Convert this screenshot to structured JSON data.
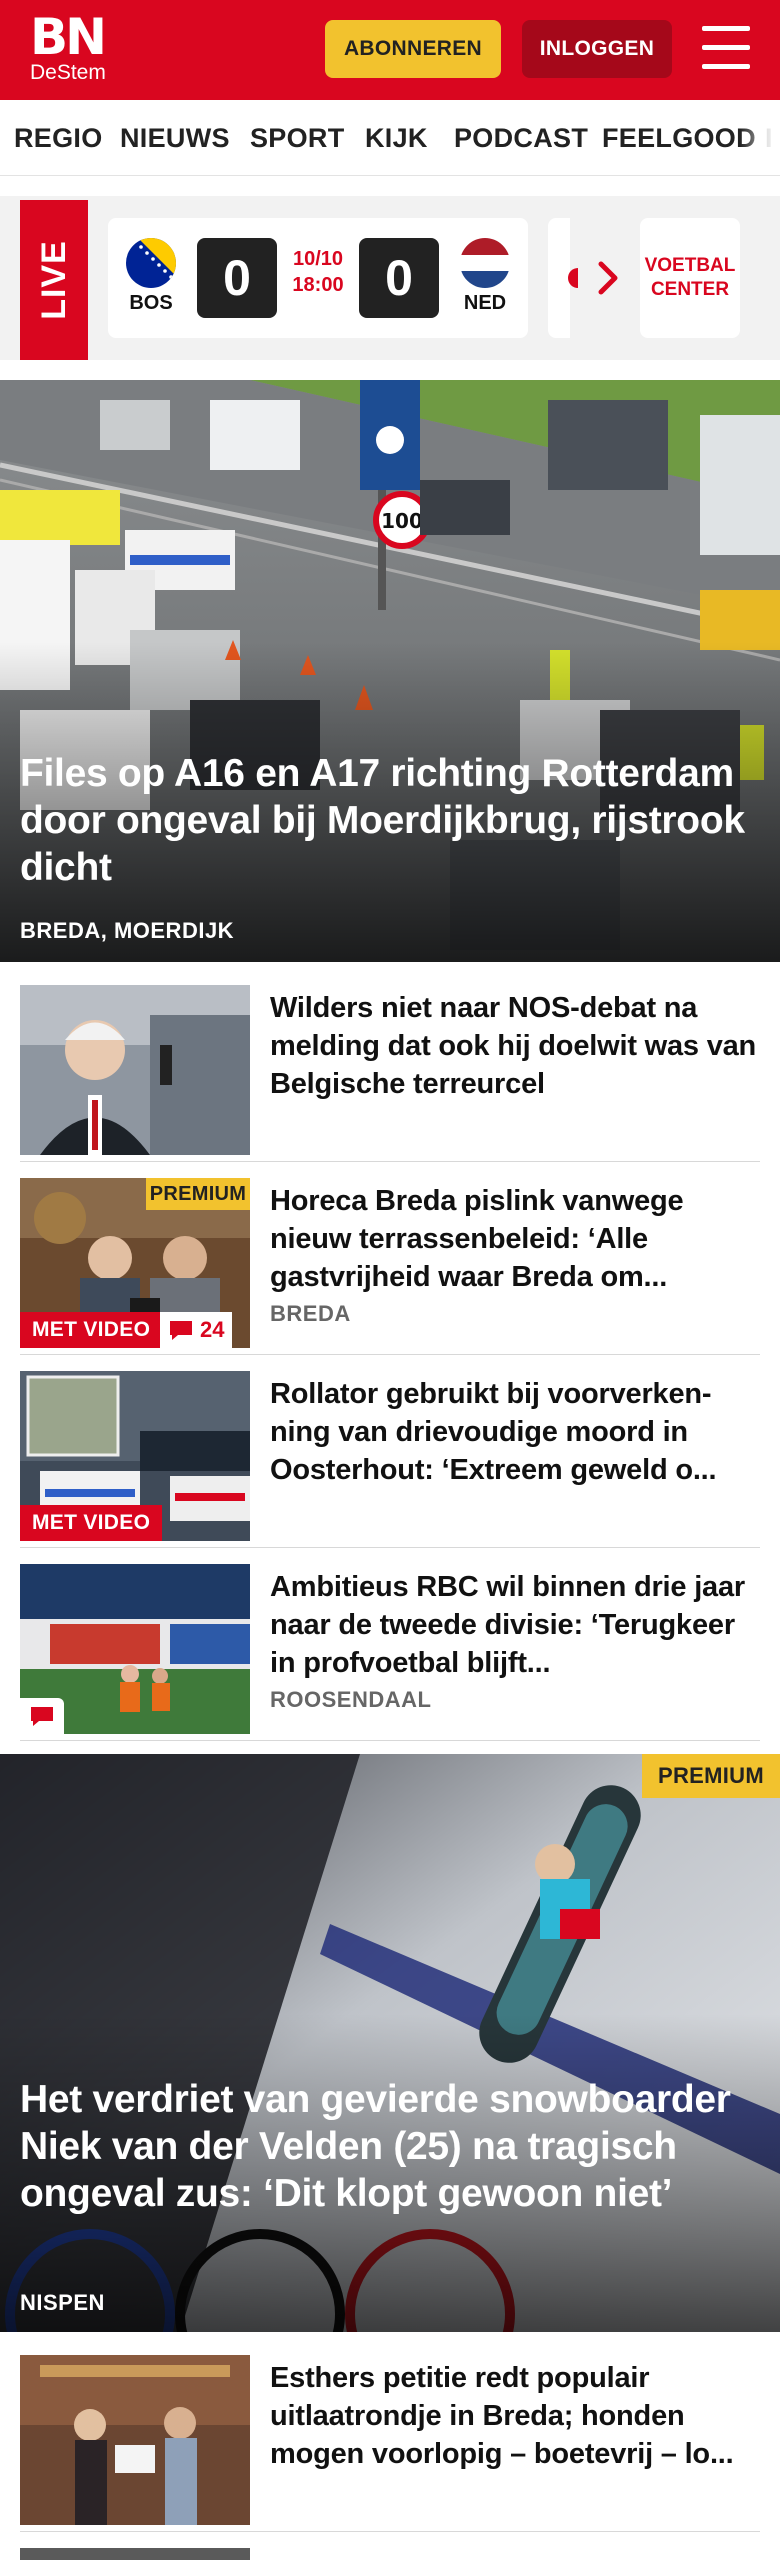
{
  "header": {
    "logo_main": "BN",
    "logo_sub": "DeStem",
    "subscribe_label": "ABONNEREN",
    "login_label": "INLOGGEN",
    "menu_icon": "hamburger-menu-icon",
    "brand_color": "#d9061f"
  },
  "nav": {
    "items": [
      "REGIO",
      "NIEUWS",
      "SPORT",
      "KIJK",
      "PODCAST",
      "FEELGOOD"
    ]
  },
  "live": {
    "label": "LIVE",
    "match": {
      "home": "BOS",
      "away": "NED",
      "home_score": "0",
      "away_score": "0",
      "date": "10/10",
      "time": "18:00"
    },
    "more_icon": "chevron-right-icon",
    "voetbal_center": "VOETBAL CENTER"
  },
  "hero": {
    "headline": "Files op A16 en A17 richting Rotterdam door ongeval bij Moerdijk­brug, rijstrook dicht",
    "location": "BREDA, MOERDIJK"
  },
  "articles": [
    {
      "title": "Wilders niet naar NOS-debat na melding dat ook hij doelwit was van Belgische terreurcel"
    },
    {
      "title": "Horeca Breda pislink vanwege nieuw terrassenbeleid: ‘Alle gastvrijheid waar Breda om...",
      "location": "BREDA",
      "premium": "PREMIUM",
      "video": "MET VIDEO",
      "comments": "24"
    },
    {
      "title": "Rollator gebruikt bij voorverken­ning van drievoudige moord in Oosterhout: ‘Extreem geweld o...",
      "video": "MET VIDEO"
    },
    {
      "title": "Ambitieus RBC wil binnen drie jaar naar de tweede divisie: ‘Terugkeer in profvoetbal blijft...",
      "location": "ROOSENDAAL",
      "comment_icon": "comment-icon"
    }
  ],
  "hero2": {
    "premium": "PREMIUM",
    "headline": "Het verdriet van gevierde snowboar­der Niek van der Velden (25) na tragisch ongeval zus: ‘Dit klopt gewoon niet’",
    "location": "NISPEN"
  },
  "articles2": [
    {
      "title": "Esthers petitie redt populair uitlaatrondje in Breda; honden mogen voorlopig – boetevrij – lo..."
    }
  ]
}
